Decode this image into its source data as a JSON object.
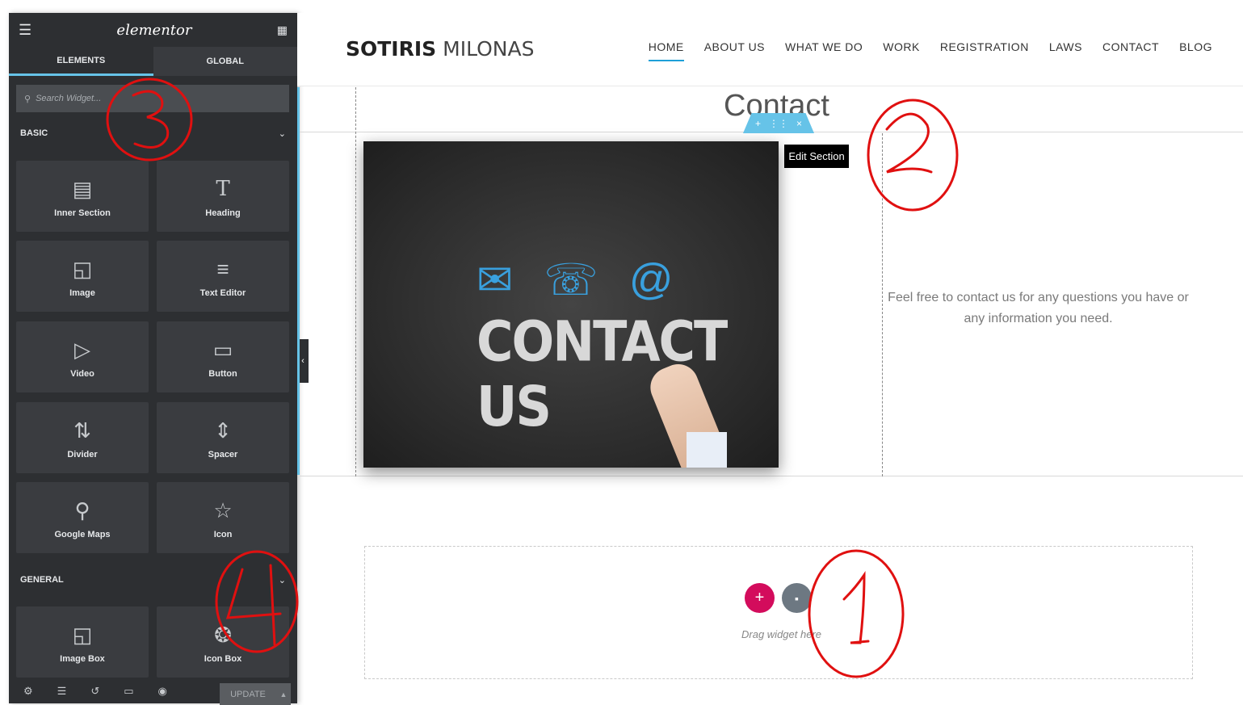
{
  "sidebar": {
    "logo": "elementor",
    "tabs": [
      {
        "label": "ELEMENTS"
      },
      {
        "label": "GLOBAL"
      }
    ],
    "search_placeholder": "Search Widget...",
    "categories": [
      {
        "label": "BASIC"
      },
      {
        "label": "GENERAL"
      }
    ],
    "widgets": [
      {
        "label": "Inner Section",
        "icon": "inner-section-icon"
      },
      {
        "label": "Heading",
        "icon": "heading-icon"
      },
      {
        "label": "Image",
        "icon": "image-icon"
      },
      {
        "label": "Text Editor",
        "icon": "text-editor-icon"
      },
      {
        "label": "Video",
        "icon": "video-icon"
      },
      {
        "label": "Button",
        "icon": "button-icon"
      },
      {
        "label": "Divider",
        "icon": "divider-icon"
      },
      {
        "label": "Spacer",
        "icon": "spacer-icon"
      },
      {
        "label": "Google Maps",
        "icon": "google-maps-icon"
      },
      {
        "label": "Icon",
        "icon": "star-icon"
      },
      {
        "label": "Image Box",
        "icon": "image-box-icon"
      },
      {
        "label": "Icon Box",
        "icon": "icon-box-icon"
      }
    ],
    "update_label": "UPDATE"
  },
  "site": {
    "title_bold": "SOTIRIS",
    "title_light": "MILONAS",
    "nav": [
      {
        "label": "HOME",
        "active": true
      },
      {
        "label": "ABOUT US"
      },
      {
        "label": "WHAT WE DO"
      },
      {
        "label": "WORK"
      },
      {
        "label": "REGISTRATION"
      },
      {
        "label": "LAWS"
      },
      {
        "label": "CONTACT"
      },
      {
        "label": "BLOG"
      }
    ]
  },
  "canvas": {
    "section_title": "Contact",
    "tooltip": "Edit Section",
    "image_text": "CONTACT US",
    "info_text": "Feel free to contact us for any questions you have or any information you need.",
    "drop_hint": "Drag widget here"
  },
  "annotations": [
    "1",
    "2",
    "3",
    "4"
  ],
  "colors": {
    "accent": "#66c3e8",
    "add_button": "#d30c5c",
    "annotation": "#e01010"
  }
}
